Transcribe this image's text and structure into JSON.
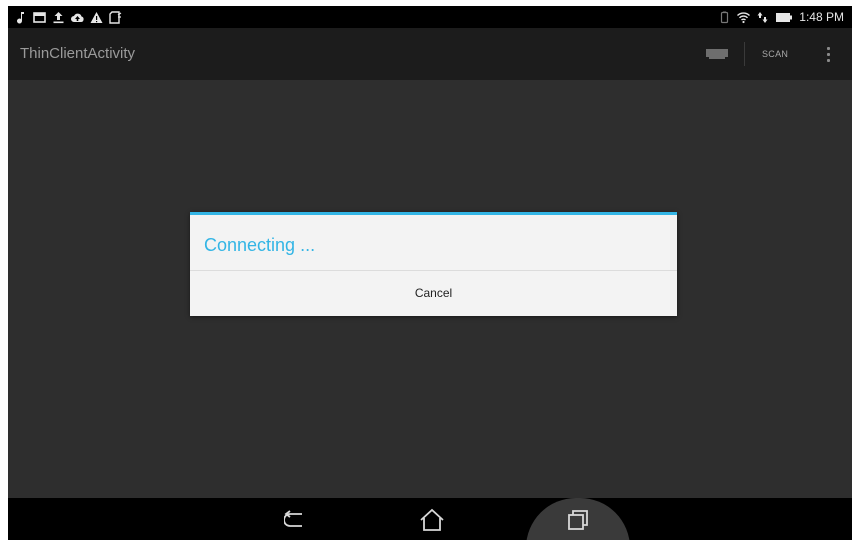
{
  "status_bar": {
    "left_icons": [
      "music-note-icon",
      "screen-capture-icon",
      "upload-icon",
      "cloud-upload-icon",
      "warning-icon",
      "sd-card-icon"
    ],
    "right_icons": [
      "battery-saver-icon",
      "wifi-icon",
      "data-transfer-icon",
      "battery-icon"
    ],
    "time": "1:48 PM"
  },
  "action_bar": {
    "title": "ThinClientActivity",
    "screen_icon": "screen-icon",
    "scan_label": "SCAN",
    "overflow_icon": "overflow-menu-icon"
  },
  "dialog": {
    "title": "Connecting ...",
    "cancel_label": "Cancel",
    "accent_color": "#33b5e5"
  },
  "nav_bar": {
    "icons": [
      "back-icon",
      "home-icon",
      "recent-apps-icon"
    ]
  }
}
